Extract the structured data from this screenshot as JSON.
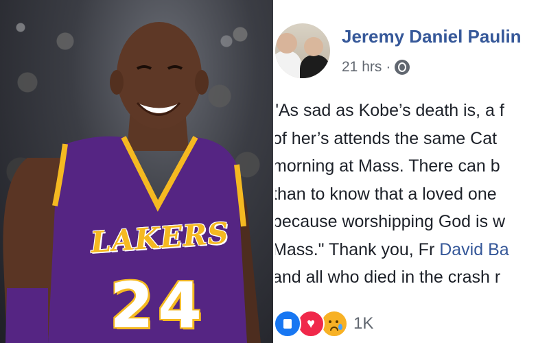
{
  "photo": {
    "jersey_logo": "LAKERS",
    "jersey_number": "24",
    "colors": {
      "jersey": "#552583",
      "trim": "#f5b921"
    }
  },
  "post": {
    "author": "Jeremy Daniel Paulin",
    "timestamp": "21 hrs",
    "separator": "·",
    "privacy_icon": "globe-icon",
    "lines": [
      "\"As sad as Kobe’s death is, a f",
      "of her’s attends the same Cat",
      "morning at Mass. There can b",
      "than to know that a loved one",
      "because worshipping God is w",
      "and all who died in the crash r"
    ],
    "line6_prefix": "Mass.\" Thank you, Fr ",
    "line6_link": "David Ba",
    "reactions": [
      "like-icon",
      "love-icon",
      "sad-icon"
    ],
    "reaction_count": "1K",
    "colors": {
      "link": "#365899",
      "text": "#1d2129",
      "meta": "#616770"
    }
  }
}
